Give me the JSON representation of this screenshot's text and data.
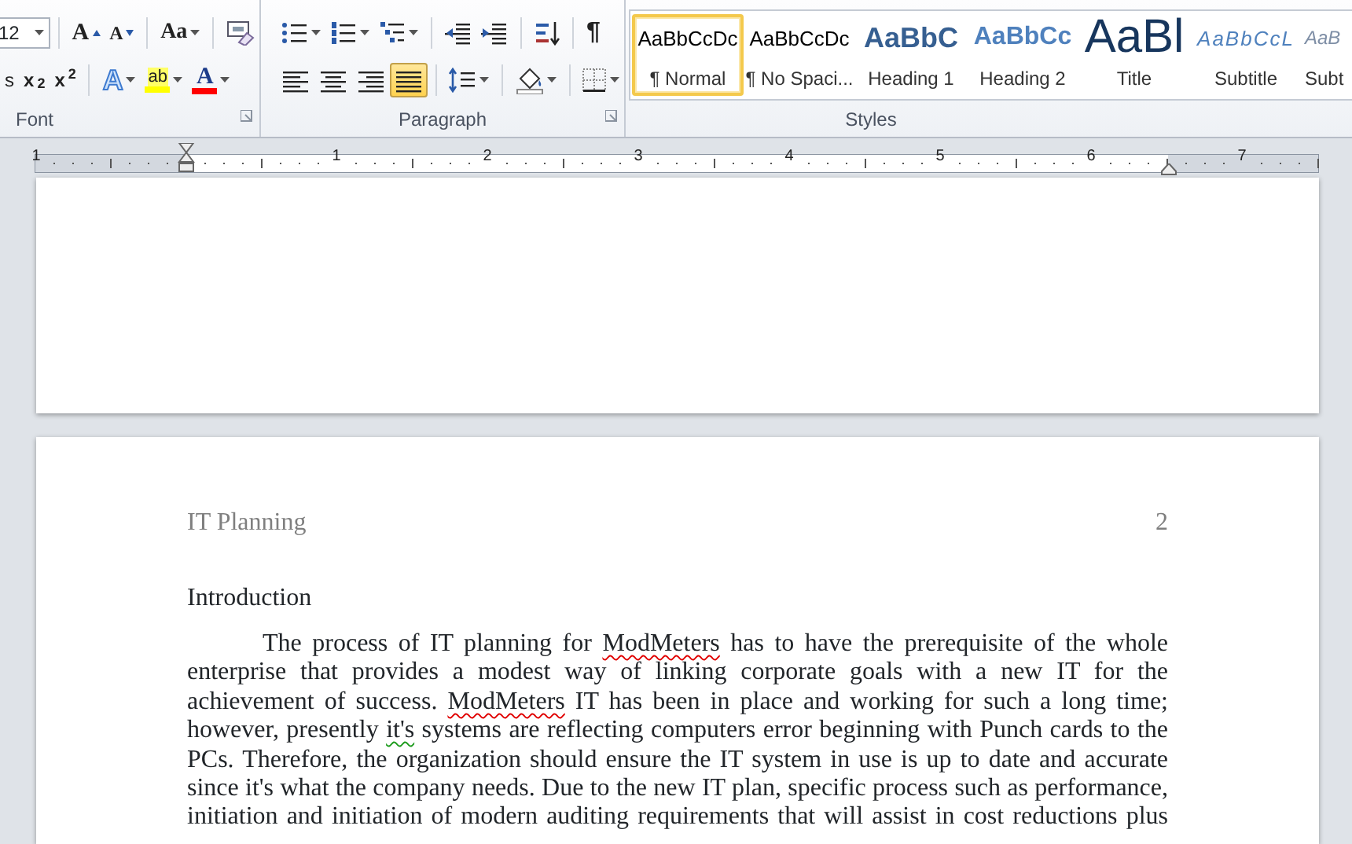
{
  "ribbon": {
    "font_group": {
      "label": "Font",
      "font_size": "12",
      "grow_font": "A",
      "shrink_font": "A",
      "change_case": "Aa",
      "strikethrough_cut": "s",
      "subscript": "x$_{2}$",
      "superscript": "x$^{2}$",
      "text_effects": "A",
      "highlight": "ab",
      "font_color": "A"
    },
    "paragraph_group": {
      "label": "Paragraph",
      "show_marks": "¶",
      "alignments": [
        {
          "kind": "left",
          "selected": false
        },
        {
          "kind": "center",
          "selected": false
        },
        {
          "kind": "right",
          "selected": false
        },
        {
          "kind": "justify",
          "selected": true
        }
      ]
    },
    "styles_group": {
      "label": "Styles",
      "styles": [
        {
          "kind": "normal",
          "sample": "AaBbCcDc",
          "name": "¶ Normal",
          "selected": true
        },
        {
          "kind": "normal",
          "sample": "AaBbCcDc",
          "name": "¶ No Spaci...",
          "selected": false
        },
        {
          "kind": "heading1",
          "sample": "AaBbC",
          "name": "Heading 1",
          "selected": false
        },
        {
          "kind": "heading2",
          "sample": "AaBbCc",
          "name": "Heading 2",
          "selected": false
        },
        {
          "kind": "title",
          "sample": "AaBl",
          "name": "Title",
          "selected": false
        },
        {
          "kind": "subtitle",
          "sample": "AaBbCcL",
          "name": "Subtitle",
          "selected": false
        },
        {
          "kind": "subtle",
          "sample": "AaB",
          "name": "Subt",
          "selected": false
        }
      ]
    }
  },
  "ruler": {
    "numbers": [
      "1",
      "1",
      "2",
      "3",
      "4",
      "5",
      "6",
      "7"
    ]
  },
  "page": {
    "header": {
      "title": "IT Planning",
      "page_number": "2"
    },
    "heading": "Introduction",
    "paragraph": [
      {
        "text": "The process of IT planning for ",
        "spelling_error": false,
        "grammar_error": false
      },
      {
        "text": "ModMeters",
        "spelling_error": true,
        "grammar_error": false
      },
      {
        "text": " has to have the prerequisite of the whole enterprise that provides a modest way of linking corporate goals with a new IT for the achievement of success. ",
        "spelling_error": false,
        "grammar_error": false
      },
      {
        "text": "ModMeters",
        "spelling_error": true,
        "grammar_error": false
      },
      {
        "text": " IT has been in place and working for such a long time; however, presently ",
        "spelling_error": false,
        "grammar_error": false
      },
      {
        "text": "it's",
        "spelling_error": false,
        "grammar_error": true
      },
      {
        "text": " systems are reflecting computers error beginning with Punch cards to the PCs. Therefore, the organization should ensure the IT system in use is up to date and accurate since it's what the company needs. Due to the new IT plan, specific process such as performance, initiation and initiation of modern auditing requirements that will assist in cost reductions plus",
        "spelling_error": false,
        "grammar_error": false
      }
    ]
  }
}
